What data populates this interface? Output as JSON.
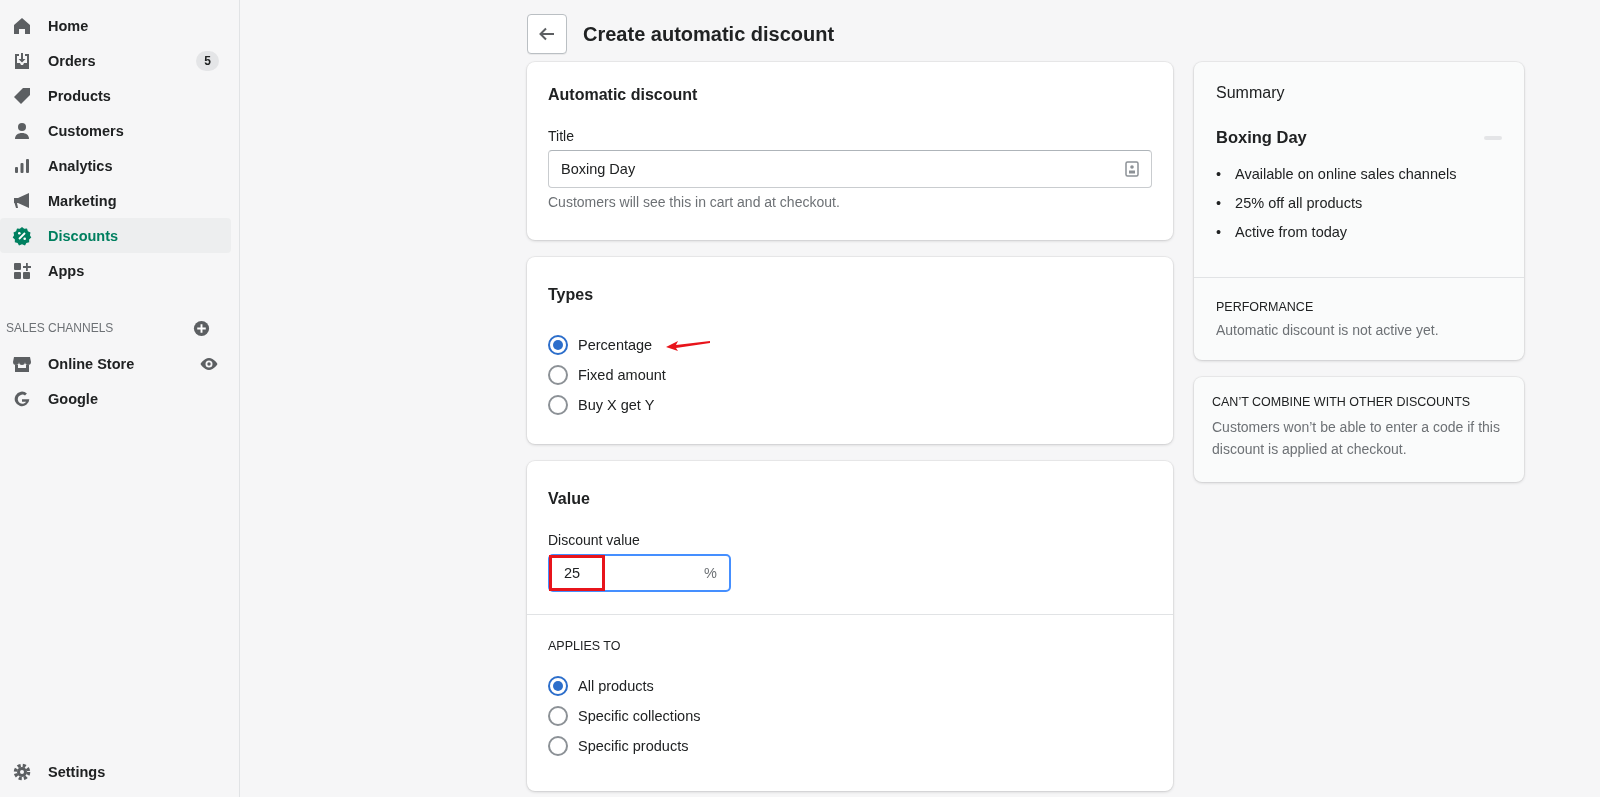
{
  "sidebar": {
    "items": [
      {
        "label": "Home",
        "selected": false
      },
      {
        "label": "Orders",
        "badge": "5",
        "selected": false
      },
      {
        "label": "Products",
        "selected": false
      },
      {
        "label": "Customers",
        "selected": false
      },
      {
        "label": "Analytics",
        "selected": false
      },
      {
        "label": "Marketing",
        "selected": false
      },
      {
        "label": "Discounts",
        "selected": true
      },
      {
        "label": "Apps",
        "selected": false
      }
    ],
    "sales_channels": {
      "heading": "SALES CHANNELS",
      "items": [
        {
          "label": "Online Store"
        },
        {
          "label": "Google"
        }
      ]
    },
    "settings": {
      "label": "Settings"
    }
  },
  "header": {
    "title": "Create automatic discount"
  },
  "title_card": {
    "heading": "Automatic discount",
    "field_label": "Title",
    "value": "Boxing Day",
    "help": "Customers will see this in cart and at checkout."
  },
  "types_card": {
    "heading": "Types",
    "options": [
      {
        "label": "Percentage",
        "selected": true,
        "annotated": true
      },
      {
        "label": "Fixed amount",
        "selected": false,
        "annotated": false
      },
      {
        "label": "Buy X get Y",
        "selected": false,
        "annotated": false
      }
    ]
  },
  "value_card": {
    "heading": "Value",
    "field_label": "Discount value",
    "value": "25",
    "suffix": "%",
    "highlighted": true,
    "applies_to": {
      "heading": "APPLIES TO",
      "options": [
        {
          "label": "All products",
          "selected": true
        },
        {
          "label": "Specific collections",
          "selected": false
        },
        {
          "label": "Specific products",
          "selected": false
        }
      ]
    }
  },
  "summary": {
    "heading": "Summary",
    "name": "Boxing Day",
    "details": [
      {
        "bullet": "•",
        "text": "Available on online sales channels"
      },
      {
        "bullet": "•",
        "text": "25% off all products"
      },
      {
        "bullet": "•",
        "text": "Active from today"
      }
    ],
    "performance": {
      "heading": "PERFORMANCE",
      "text": "Automatic discount is not active yet."
    }
  },
  "combine_note": {
    "heading": "CAN’T COMBINE WITH OTHER DISCOUNTS",
    "text": "Customers won’t be able to enter a code if this discount is applied at checkout."
  }
}
